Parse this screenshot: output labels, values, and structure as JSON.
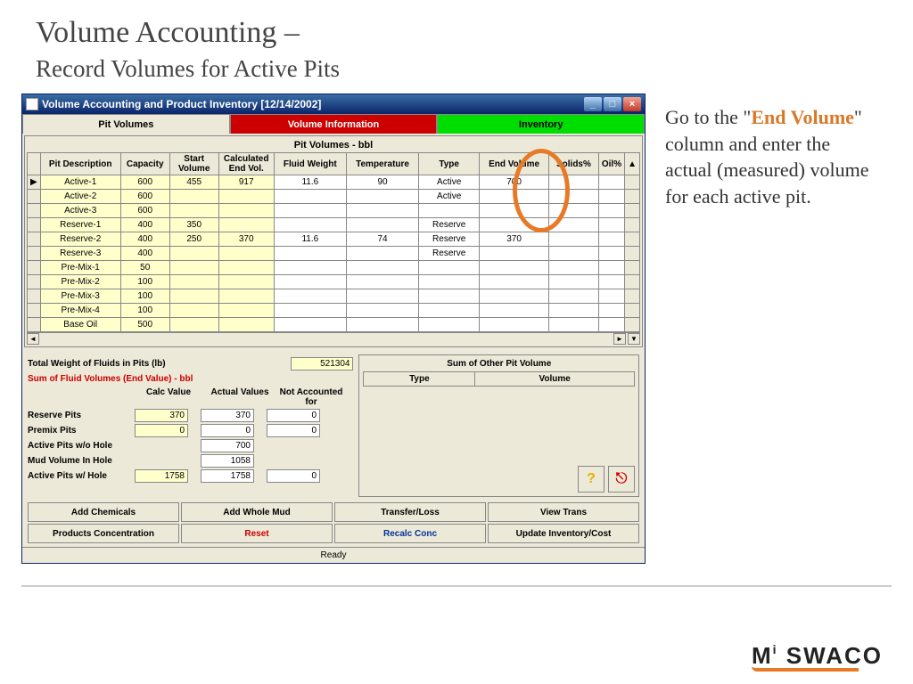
{
  "slide": {
    "title": "Volume Accounting –",
    "subtitle": "Record Volumes for Active Pits",
    "instruction_pre": "Go to the \"",
    "instruction_em": "End Volume",
    "instruction_post": "\" column and enter the actual (measured) volume for each active pit."
  },
  "window": {
    "title": "Volume Accounting and Product Inventory [12/14/2002]",
    "tabs": {
      "pit_volumes": "Pit Volumes",
      "volume_info": "Volume Information",
      "inventory": "Inventory"
    },
    "grid_title": "Pit Volumes - bbl",
    "columns": {
      "desc": "Pit Description",
      "capacity": "Capacity",
      "start": "Start Volume",
      "calc": "Calculated End Vol.",
      "weight": "Fluid Weight",
      "temp": "Temperature",
      "type": "Type",
      "end": "End Volume",
      "solids": "Solids%",
      "oil": "Oil%"
    },
    "rows": [
      {
        "desc": "Active-1",
        "cap": "600",
        "start": "455",
        "calc": "917",
        "weight": "11.6",
        "temp": "90",
        "type": "Active",
        "end": "700"
      },
      {
        "desc": "Active-2",
        "cap": "600",
        "start": "",
        "calc": "",
        "weight": "",
        "temp": "",
        "type": "Active",
        "end": ""
      },
      {
        "desc": "Active-3",
        "cap": "600",
        "start": "",
        "calc": "",
        "weight": "",
        "temp": "",
        "type": "",
        "end": ""
      },
      {
        "desc": "Reserve-1",
        "cap": "400",
        "start": "350",
        "calc": "",
        "weight": "",
        "temp": "",
        "type": "Reserve",
        "end": ""
      },
      {
        "desc": "Reserve-2",
        "cap": "400",
        "start": "250",
        "calc": "370",
        "weight": "11.6",
        "temp": "74",
        "type": "Reserve",
        "end": "370"
      },
      {
        "desc": "Reserve-3",
        "cap": "400",
        "start": "",
        "calc": "",
        "weight": "",
        "temp": "",
        "type": "Reserve",
        "end": ""
      },
      {
        "desc": "Pre-Mix-1",
        "cap": "50",
        "start": "",
        "calc": "",
        "weight": "",
        "temp": "",
        "type": "",
        "end": ""
      },
      {
        "desc": "Pre-Mix-2",
        "cap": "100",
        "start": "",
        "calc": "",
        "weight": "",
        "temp": "",
        "type": "",
        "end": ""
      },
      {
        "desc": "Pre-Mix-3",
        "cap": "100",
        "start": "",
        "calc": "",
        "weight": "",
        "temp": "",
        "type": "",
        "end": ""
      },
      {
        "desc": "Pre-Mix-4",
        "cap": "100",
        "start": "",
        "calc": "",
        "weight": "",
        "temp": "",
        "type": "",
        "end": ""
      },
      {
        "desc": "Base Oil",
        "cap": "500",
        "start": "",
        "calc": "",
        "weight": "",
        "temp": "",
        "type": "",
        "end": ""
      }
    ],
    "total_weight_label": "Total Weight of Fluids in Pits (lb)",
    "total_weight_value": "521304",
    "sum_title": "Sum of Fluid Volumes (End Value) - bbl",
    "sum_cols": {
      "calc": "Calc Value",
      "actual": "Actual Values",
      "notacc": "Not Accounted for"
    },
    "sum_rows": {
      "reserve": {
        "label": "Reserve Pits",
        "calc": "370",
        "actual": "370",
        "notacc": "0"
      },
      "premix": {
        "label": "Premix Pits",
        "calc": "0",
        "actual": "0",
        "notacc": "0"
      },
      "act_wo": {
        "label": "Active Pits w/o Hole",
        "calc": "",
        "actual": "700",
        "notacc": ""
      },
      "mud": {
        "label": "Mud Volume In Hole",
        "calc": "",
        "actual": "1058",
        "notacc": ""
      },
      "act_w": {
        "label": "Active Pits w/ Hole",
        "calc": "1758",
        "actual": "1758",
        "notacc": "0"
      }
    },
    "other_pit_title": "Sum of Other Pit Volume",
    "other_pit_cols": {
      "type": "Type",
      "volume": "Volume"
    },
    "buttons": {
      "add_chem": "Add Chemicals",
      "add_mud": "Add Whole Mud",
      "transfer": "Transfer/Loss",
      "view": "View Trans",
      "prod_conc": "Products Concentration",
      "reset": "Reset",
      "recalc": "Recalc Conc",
      "update": "Update Inventory/Cost"
    },
    "status": "Ready"
  },
  "logo": {
    "brand": "M",
    "brand2": "SWACO",
    "i": "i"
  }
}
